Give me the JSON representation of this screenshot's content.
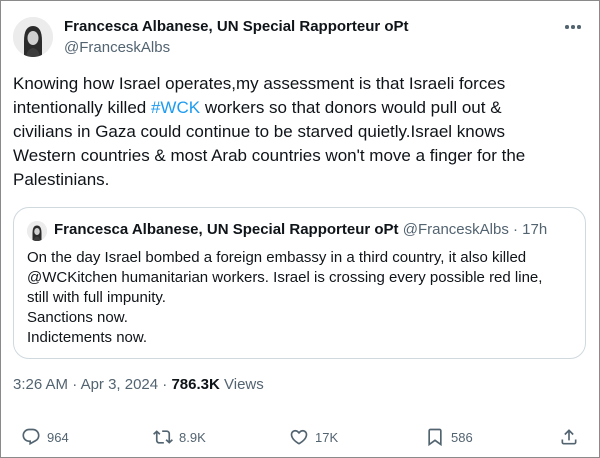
{
  "author": {
    "display_name": "Francesca Albanese, UN Special Rapporteur oPt",
    "handle": "@FranceskAlbs"
  },
  "tweet": {
    "text_before": "Knowing how Israel operates,my assessment is that Israeli forces\nintentionally killed ",
    "hashtag": "#WCK",
    "text_after": " workers so that donors would pull out &\ncivilians in Gaza could continue to be starved quietly.Israel knows\nWestern countries & most Arab countries won't move a finger for the\nPalestinians."
  },
  "quoted_tweet": {
    "display_name": "Francesca Albanese, UN Special Rapporteur oPt",
    "handle": "@FranceskAlbs",
    "separator": "·",
    "time_ago": "17h",
    "text": "On the day Israel bombed a foreign embassy in a third country,  it also killed\n@WCKitchen humanitarian workers. Israel is crossing every possible red line,\nstill with full impunity.\nSanctions now.\nIndictements now."
  },
  "meta": {
    "time": "3:26 AM",
    "dot": "·",
    "date": "Apr 3, 2024",
    "views_count": "786.3K",
    "views_label": "Views"
  },
  "actions": {
    "replies": "964",
    "reposts": "8.9K",
    "likes": "17K",
    "bookmarks": "586"
  },
  "colors": {
    "accent": "#1d9bf0",
    "text": "#0f1419",
    "secondary": "#536471",
    "border": "#cfd9de"
  },
  "icons": [
    "more-icon",
    "reply-icon",
    "repost-icon",
    "like-icon",
    "bookmark-icon",
    "share-icon"
  ]
}
